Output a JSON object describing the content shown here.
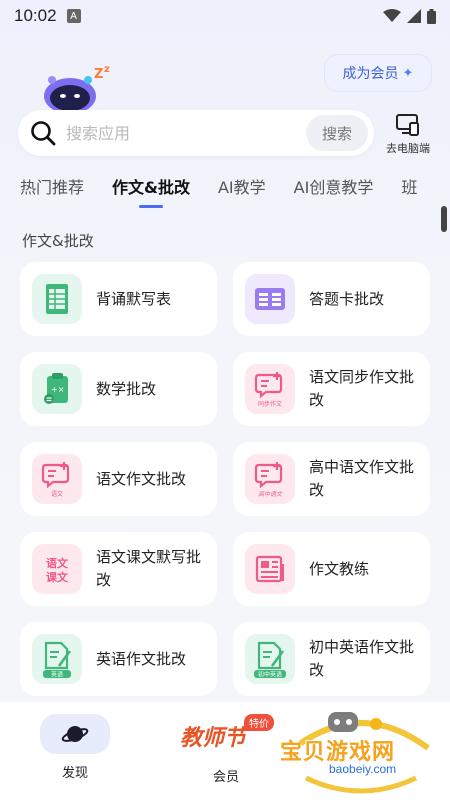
{
  "status_bar": {
    "time": "10:02",
    "notification_letter": "A"
  },
  "header": {
    "vip_label": "成为会员"
  },
  "search": {
    "placeholder": "搜索应用",
    "button_label": "搜索",
    "pc_label": "去电脑端"
  },
  "tabs": [
    "热门推荐",
    "作文&批改",
    "AI教学",
    "AI创意教学",
    "班"
  ],
  "active_tab_index": 1,
  "section_title": "作文&批改",
  "items": [
    {
      "label": "背诵默写表",
      "icon": "sheet-icon",
      "color": "green"
    },
    {
      "label": "答题卡批改",
      "icon": "answer-card-icon",
      "color": "purple"
    },
    {
      "label": "数学批改",
      "icon": "math-clipboard-icon",
      "color": "green"
    },
    {
      "label": "语文同步作文批改",
      "icon": "chat-edit-icon",
      "color": "pink",
      "icon_text": "同步作文"
    },
    {
      "label": "语文作文批改",
      "icon": "chat-edit-icon",
      "color": "pink",
      "icon_text": "语文"
    },
    {
      "label": "高中语文作文批改",
      "icon": "chat-edit-icon",
      "color": "pink",
      "icon_text": "高中语文"
    },
    {
      "label": "语文课文默写批改",
      "icon": "text-badge-icon",
      "color": "pink",
      "icon_text": "语文课文"
    },
    {
      "label": "作文教练",
      "icon": "newspaper-icon",
      "color": "pink"
    },
    {
      "label": "英语作文批改",
      "icon": "doc-pen-icon",
      "color": "green",
      "icon_text": "英语"
    },
    {
      "label": "初中英语作文批改",
      "icon": "doc-pen-icon",
      "color": "green",
      "icon_text": "初中英语"
    }
  ],
  "bottom_nav": {
    "discover_label": "发现",
    "promo_title": "教师节",
    "promo_badge": "特价",
    "member_label": "会员"
  },
  "watermark": {
    "title": "宝贝游戏网",
    "url": "baobeiy.com"
  },
  "colors": {
    "accent": "#4a6cf0",
    "green_icon": "#3fb77b",
    "purple_icon": "#9b7cf0",
    "pink_icon": "#ef5a86"
  }
}
